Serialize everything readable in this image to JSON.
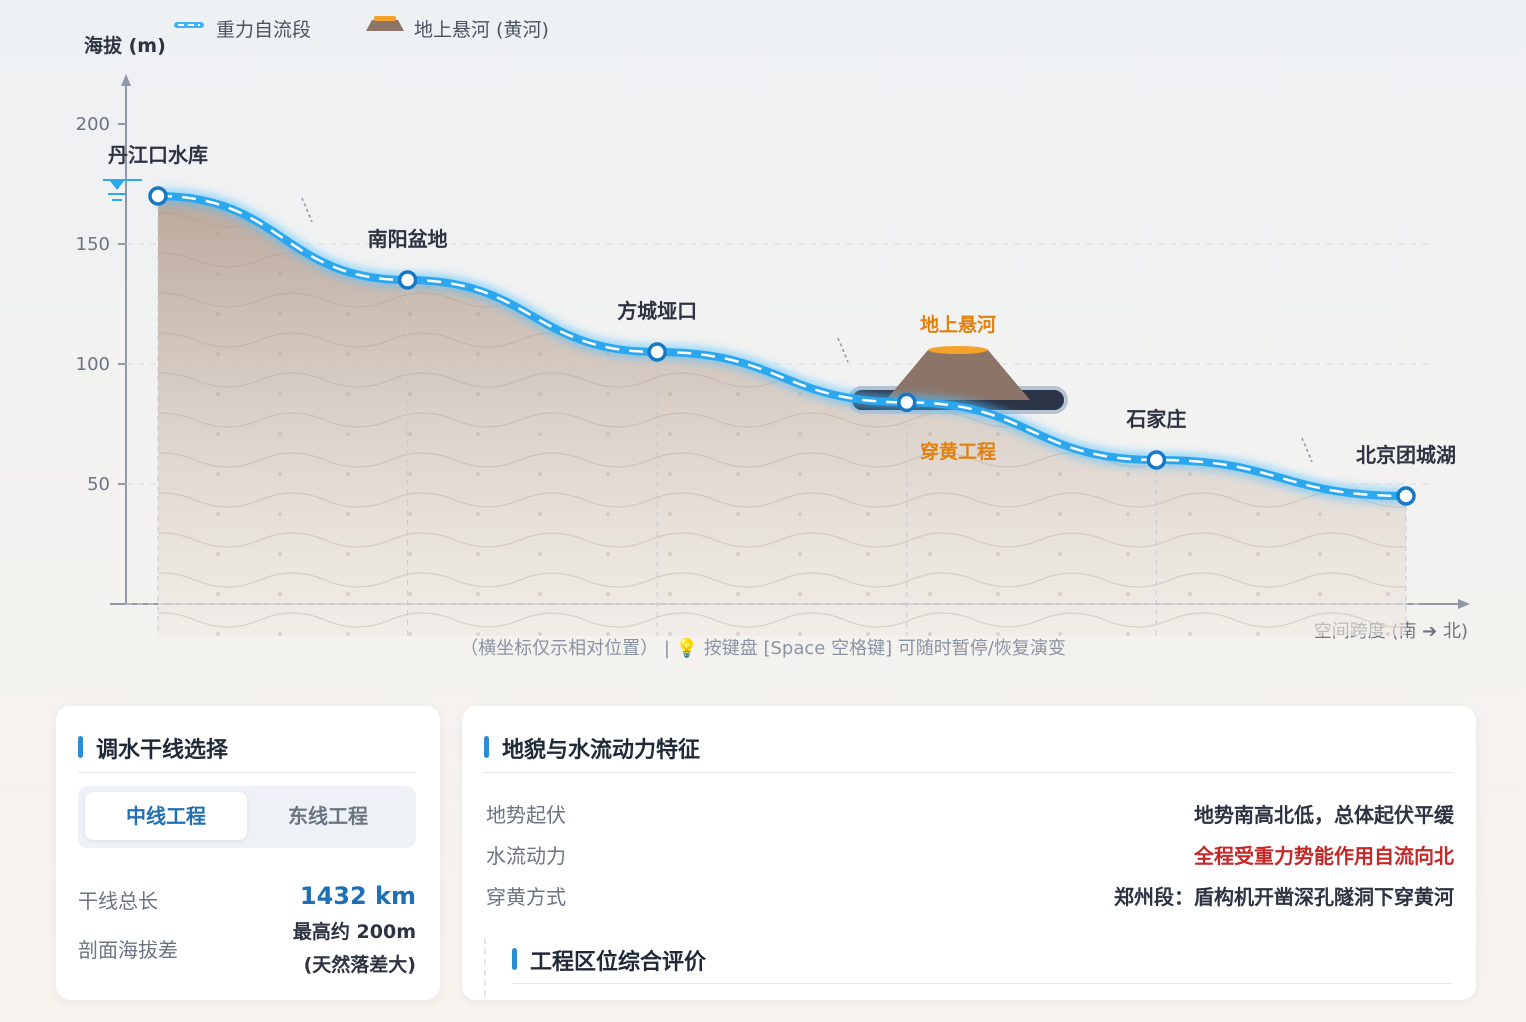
{
  "legend": {
    "gravity_label": "重力自流段",
    "river_label": "地上悬河 (黄河)"
  },
  "chart_data": {
    "type": "area",
    "ylabel": "海拔 (m)",
    "xlabel": "空间跨度 (南 ➔ 北)",
    "ylim": [
      0,
      200
    ],
    "yticks": [
      50,
      100,
      150,
      200
    ],
    "grid": true,
    "points": [
      {
        "name": "丹江口水库",
        "x": 0,
        "y": 170
      },
      {
        "name": "南阳盆地",
        "x": 1,
        "y": 135
      },
      {
        "name": "方城垭口",
        "x": 2,
        "y": 105
      },
      {
        "name": "",
        "x": 3,
        "y": 84
      },
      {
        "name": "石家庄",
        "x": 4,
        "y": 60
      },
      {
        "name": "北京团城湖",
        "x": 5,
        "y": 45
      }
    ],
    "annotations": {
      "river_label": "地上悬河",
      "tunnel_label": "穿黄工程"
    }
  },
  "caption": "（横坐标仅示相对位置） | 💡 按键盘 [Space 空格键] 可随时暂停/恢复演变",
  "colors": {
    "water": "#2aa7ef",
    "terrain": "#b9a79a",
    "river": "#8c7468",
    "river_top": "#f3a22a",
    "accent": "#2b8cd6",
    "orange": "#e0810f",
    "red": "#c62828"
  },
  "route_panel": {
    "title": "调水干线选择",
    "tabs": [
      {
        "label": "中线工程",
        "active": true
      },
      {
        "label": "东线工程",
        "active": false
      }
    ],
    "length_label": "干线总长",
    "length_value": "1432 km",
    "diff_label": "剖面海拔差",
    "diff_value_1": "最高约 200m",
    "diff_value_2": "(天然落差大)"
  },
  "feature_panel": {
    "title": "地貌与水流动力特征",
    "rows": [
      {
        "label": "地势起伏",
        "value": "地势南高北低，总体起伏平缓"
      },
      {
        "label": "水流动力",
        "value": "全程受重力势能作用自流向北"
      },
      {
        "label": "穿黄方式",
        "value": "郑州段：盾构机开凿深孔隧洞下穿黄河"
      }
    ],
    "sub_title": "工程区位综合评价"
  }
}
